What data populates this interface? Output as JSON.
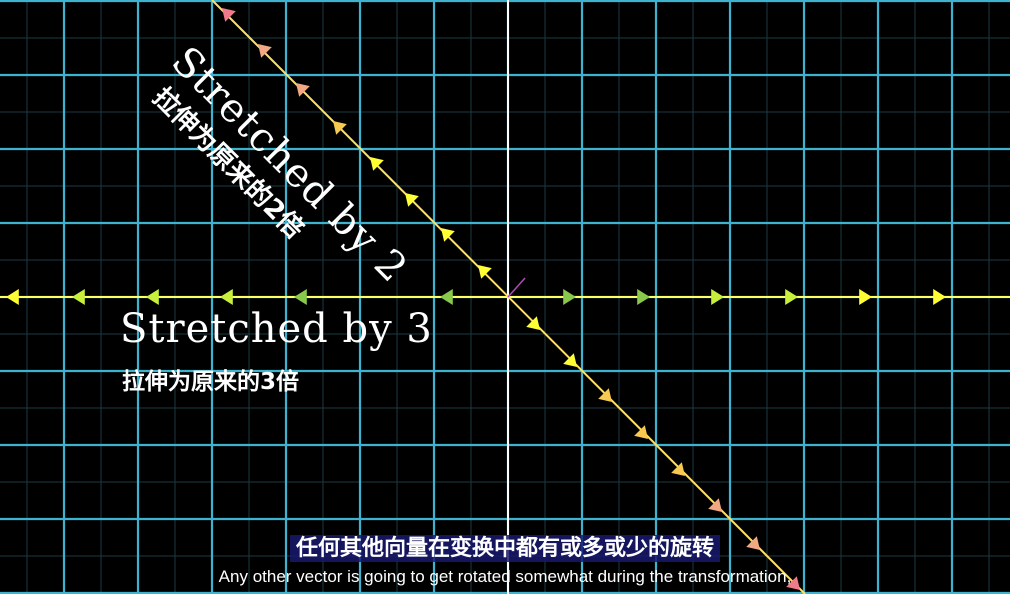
{
  "labels": {
    "diagonal_en": "Stretched by 2",
    "diagonal_cn": "拉伸为原来的2倍",
    "horizontal_en": "Stretched by 3",
    "horizontal_cn": "拉伸为原来的3倍"
  },
  "subtitles": {
    "cn": "任何其他向量在变换中都有或多或少的旋转",
    "en": "Any other vector is going to get rotated somewhat during the transformation,"
  },
  "colors": {
    "background": "#000000",
    "grid_major": "#3db3d0",
    "grid_minor": "#1b3a44",
    "axis": "#ffffff",
    "horizontal_line": "#ffff66",
    "diagonal_line": "#ffe066",
    "arrow_yellow": "#ffff33",
    "arrow_lime": "#c8ef3c",
    "arrow_green": "#88c84a",
    "arrow_gold": "#f7c950",
    "arrow_salmon": "#f2a882",
    "arrow_red": "#f07a8a",
    "small_vector": "#b04ab8"
  }
}
